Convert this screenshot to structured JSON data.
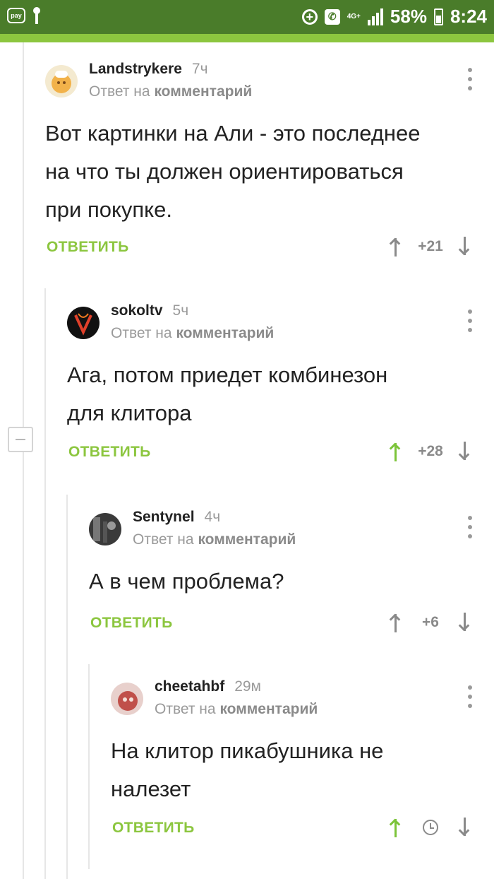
{
  "status_bar": {
    "pay_label": "pay",
    "network": "4G+",
    "battery": "58%",
    "time": "8:24"
  },
  "comments": [
    {
      "author": "Landstrykere",
      "time": "7ч",
      "reply_prefix": "Ответ на",
      "reply_target": "комментарий",
      "text": [
        "Вот картинки на Али - это последнее",
        "на что ты должен ориентироваться",
        "при покупке."
      ],
      "reply_label": "ОТВЕТИТЬ",
      "score": "+21",
      "upvoted": false
    },
    {
      "author": "sokoltv",
      "time": "5ч",
      "reply_prefix": "Ответ на",
      "reply_target": "комментарий",
      "text": [
        "Ага, потом приедет комбинезон",
        "для клитора"
      ],
      "reply_label": "ОТВЕТИТЬ",
      "score": "+28",
      "upvoted": true
    },
    {
      "author": "Sentynel",
      "time": "4ч",
      "reply_prefix": "Ответ на",
      "reply_target": "комментарий",
      "text": [
        "А в чем проблема?"
      ],
      "reply_label": "ОТВЕТИТЬ",
      "score": "+6",
      "upvoted": false
    },
    {
      "author": "cheetahbf",
      "time": "29м",
      "reply_prefix": "Ответ на",
      "reply_target": "комментарий",
      "text": [
        "На клитор пикабушника не",
        "налезет"
      ],
      "reply_label": "ОТВЕТИТЬ",
      "score": null,
      "upvoted": true
    }
  ]
}
